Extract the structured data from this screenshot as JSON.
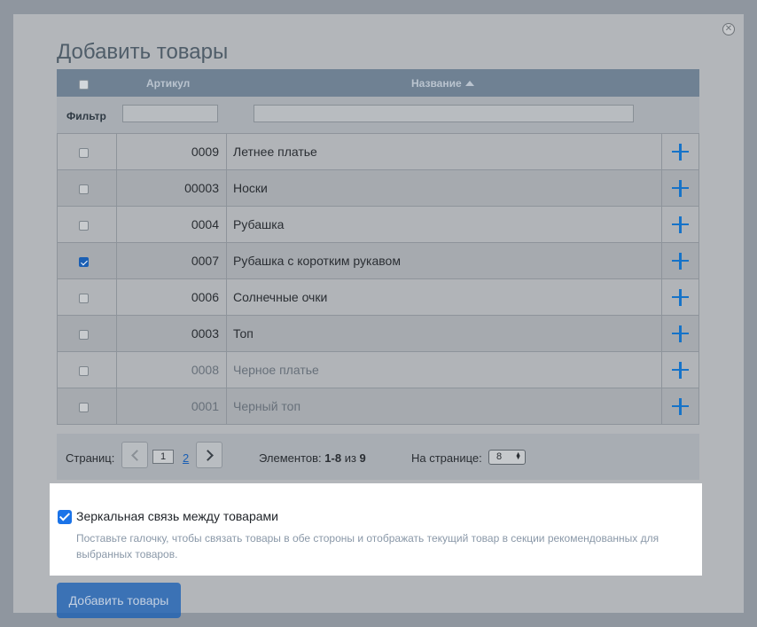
{
  "dialog": {
    "title": "Добавить товары",
    "close_icon": "close-icon"
  },
  "grid": {
    "columns": {
      "sku": "Артикул",
      "name": "Название",
      "sort": "ascending"
    },
    "filter_label": "Фильтр",
    "rows": [
      {
        "sku": "0009",
        "name": "Летнее платье",
        "checked": false,
        "muted": false
      },
      {
        "sku": "00003",
        "name": "Носки",
        "checked": false,
        "muted": false
      },
      {
        "sku": "0004",
        "name": "Рубашка",
        "checked": false,
        "muted": false
      },
      {
        "sku": "0007",
        "name": "Рубашка с коротким рукавом",
        "checked": true,
        "muted": false
      },
      {
        "sku": "0006",
        "name": "Солнечные очки",
        "checked": false,
        "muted": false
      },
      {
        "sku": "0003",
        "name": "Топ",
        "checked": false,
        "muted": false
      },
      {
        "sku": "0008",
        "name": "Черное платье",
        "checked": false,
        "muted": true
      },
      {
        "sku": "0001",
        "name": "Черный топ",
        "checked": false,
        "muted": true
      }
    ]
  },
  "pager": {
    "pages_label": "Страниц:",
    "current_page": "1",
    "next_page": "2",
    "items_label": "Элементов:",
    "items_range": "1-8",
    "items_of": "из",
    "items_total": "9",
    "per_page_label": "На странице:",
    "per_page_value": "8"
  },
  "mirror": {
    "checked": true,
    "label": "Зеркальная связь между товарами",
    "hint": "Поставьте галочку, чтобы связать товары в обе стороны и отображать текущий товар в секции рекомендованных для выбранных товаров."
  },
  "submit_label": "Добавить товары",
  "colors": {
    "accent": "#1a5fb4",
    "plus": "#1673c8",
    "header": "#6f8193"
  }
}
